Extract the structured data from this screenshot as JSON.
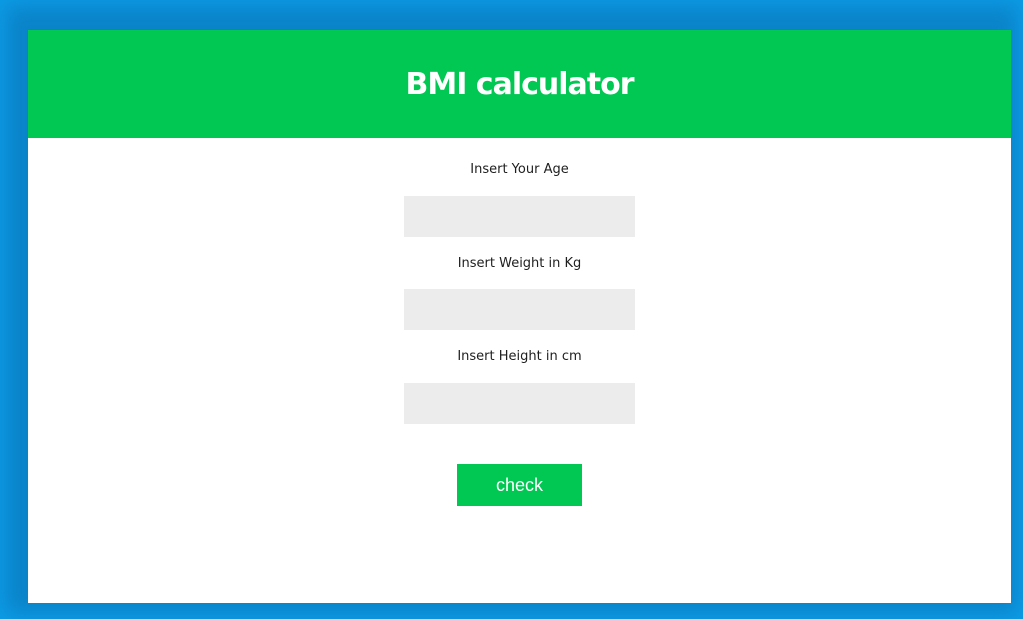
{
  "app": {
    "title": "BMI calculator"
  },
  "form": {
    "age": {
      "label": "Insert Your Age",
      "value": ""
    },
    "weight": {
      "label": "Insert Weight in Kg",
      "value": ""
    },
    "height": {
      "label": "Insert Height in cm",
      "value": ""
    },
    "submit_label": "check"
  },
  "colors": {
    "background": "#0c9be6",
    "accent": "#00c853",
    "input_background": "#ececec"
  }
}
